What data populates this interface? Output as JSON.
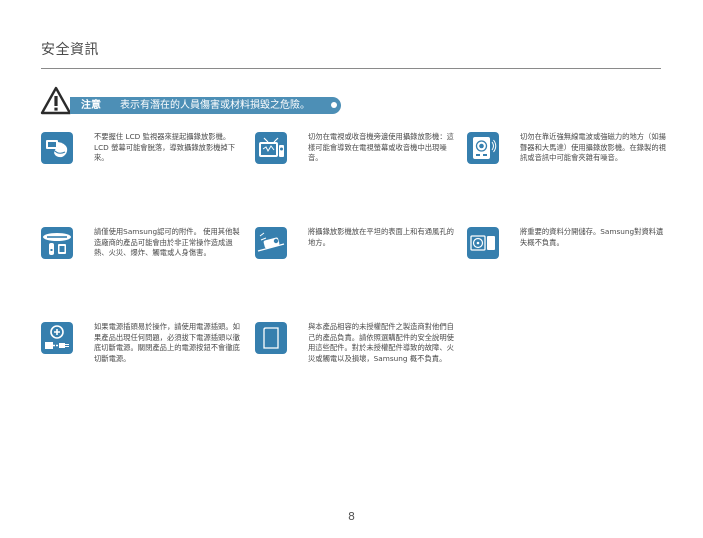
{
  "page": {
    "title": "安全資訊",
    "number": "8"
  },
  "warning": {
    "label": "注意",
    "message": "表示有潛在的人員傷害或材料損毀之危險。"
  },
  "items": [
    {
      "icon": "hand-holding-camera-icon",
      "text": "不要握住 LCD 監視器來提起攝錄放影機。LCD 螢幕可能會脫落，導致攝錄放影機掉下來。"
    },
    {
      "icon": "tv-interference-icon",
      "text": "切勿在電視或收音機旁邊使用攝錄放影機：這樣可能會導致在電視螢幕或收音機中出現噪音。"
    },
    {
      "icon": "magnetic-interference-icon",
      "text": "切勿在靠近強無線電波或強磁力的地方（如揚聲器和大馬達）使用攝錄放影機。在錄製的視訊或音訊中可能會夾雜有噪音。"
    },
    {
      "icon": "samsung-accessories-icon",
      "text": "請僅使用Samsung認可的附件。 使用其他製造廠商的產品可能會由於非正常操作造成過熱、火災、爆炸、觸電或人身傷害。"
    },
    {
      "icon": "flat-surface-camera-icon",
      "text": "將攝錄放影機放在平坦的表面上和有通風孔的地方。"
    },
    {
      "icon": "backup-disc-icon",
      "text": "將重要的資料分開儲存。Samsung對資料遺失概不負責。"
    },
    {
      "icon": "power-plug-icon",
      "text": "如果電源插頭易於操作，請使用電源插頭。如果產品出現任何問題，必須拔下電源插頭以徹底切斷電源。關閉產品上的電源按鈕不會徹底切斷電源。"
    },
    {
      "icon": "memory-card-icon",
      "text": "與本產品相容的未授權配件之製造商對他們自己的產品負責。請依照選購配件的安全說明使用這些配件。對於未授權配件導致的故障、火災或觸電以及損壞，Samsung 概不負責。"
    }
  ],
  "colors": {
    "icon_bg": "#367fae",
    "warning_bar": "#4d8fb6",
    "text": "#4a4a4a"
  }
}
